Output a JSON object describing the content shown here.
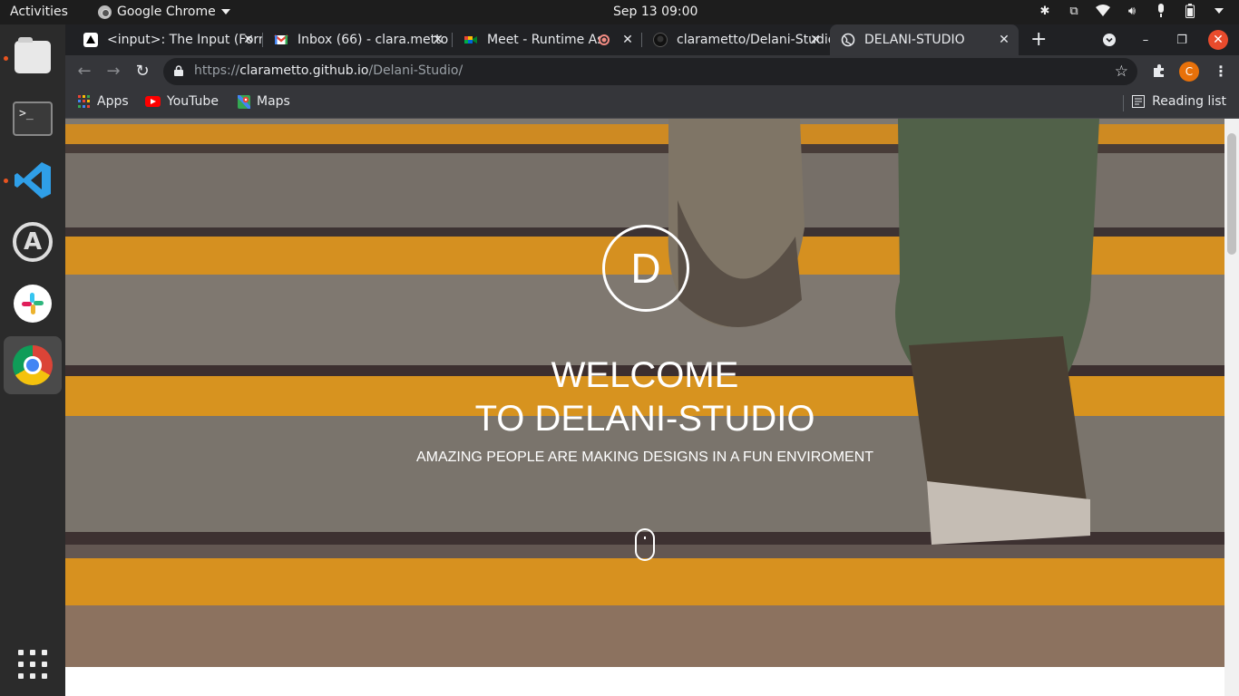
{
  "topbar": {
    "activities": "Activities",
    "app_name": "Google Chrome",
    "clock": "Sep 13  09:00"
  },
  "dock": {
    "apps": [
      "files",
      "terminal",
      "vscode",
      "software-center",
      "slack",
      "chrome"
    ],
    "terminal_prompt": ">_"
  },
  "tabs": [
    {
      "title": "<input>: The Input (Form",
      "icon": "mdn-icon"
    },
    {
      "title": "Inbox (66) - clara.metto",
      "icon": "gmail-icon"
    },
    {
      "title": "Meet - Runtime Assa",
      "icon": "meet-icon"
    },
    {
      "title": "clarametto/Delani-Studio",
      "icon": "github-icon"
    },
    {
      "title": "DELANI-STUDIO",
      "icon": "globe-icon",
      "active": true
    }
  ],
  "address_bar": {
    "scheme": "https://",
    "host": "clarametto.github.io",
    "path": "/Delani-Studio/"
  },
  "profile_initial": "C",
  "bookmarks": [
    {
      "label": "Apps",
      "icon": "apps-grid-icon"
    },
    {
      "label": "YouTube",
      "icon": "youtube-icon"
    },
    {
      "label": "Maps",
      "icon": "maps-icon"
    }
  ],
  "reading_list": "Reading list",
  "hero": {
    "logo_letter": "D",
    "title_line1": "WELCOME",
    "title_line2": "TO DELANI-STUDIO",
    "subtitle": "AMAZING PEOPLE ARE MAKING DESIGNS IN A FUN ENVIROMENT"
  },
  "colors": {
    "accent_orange": "#f2a21c",
    "chrome_dark": "#202124",
    "chrome_toolbar": "#35363a",
    "close_red": "#e94b2c"
  }
}
